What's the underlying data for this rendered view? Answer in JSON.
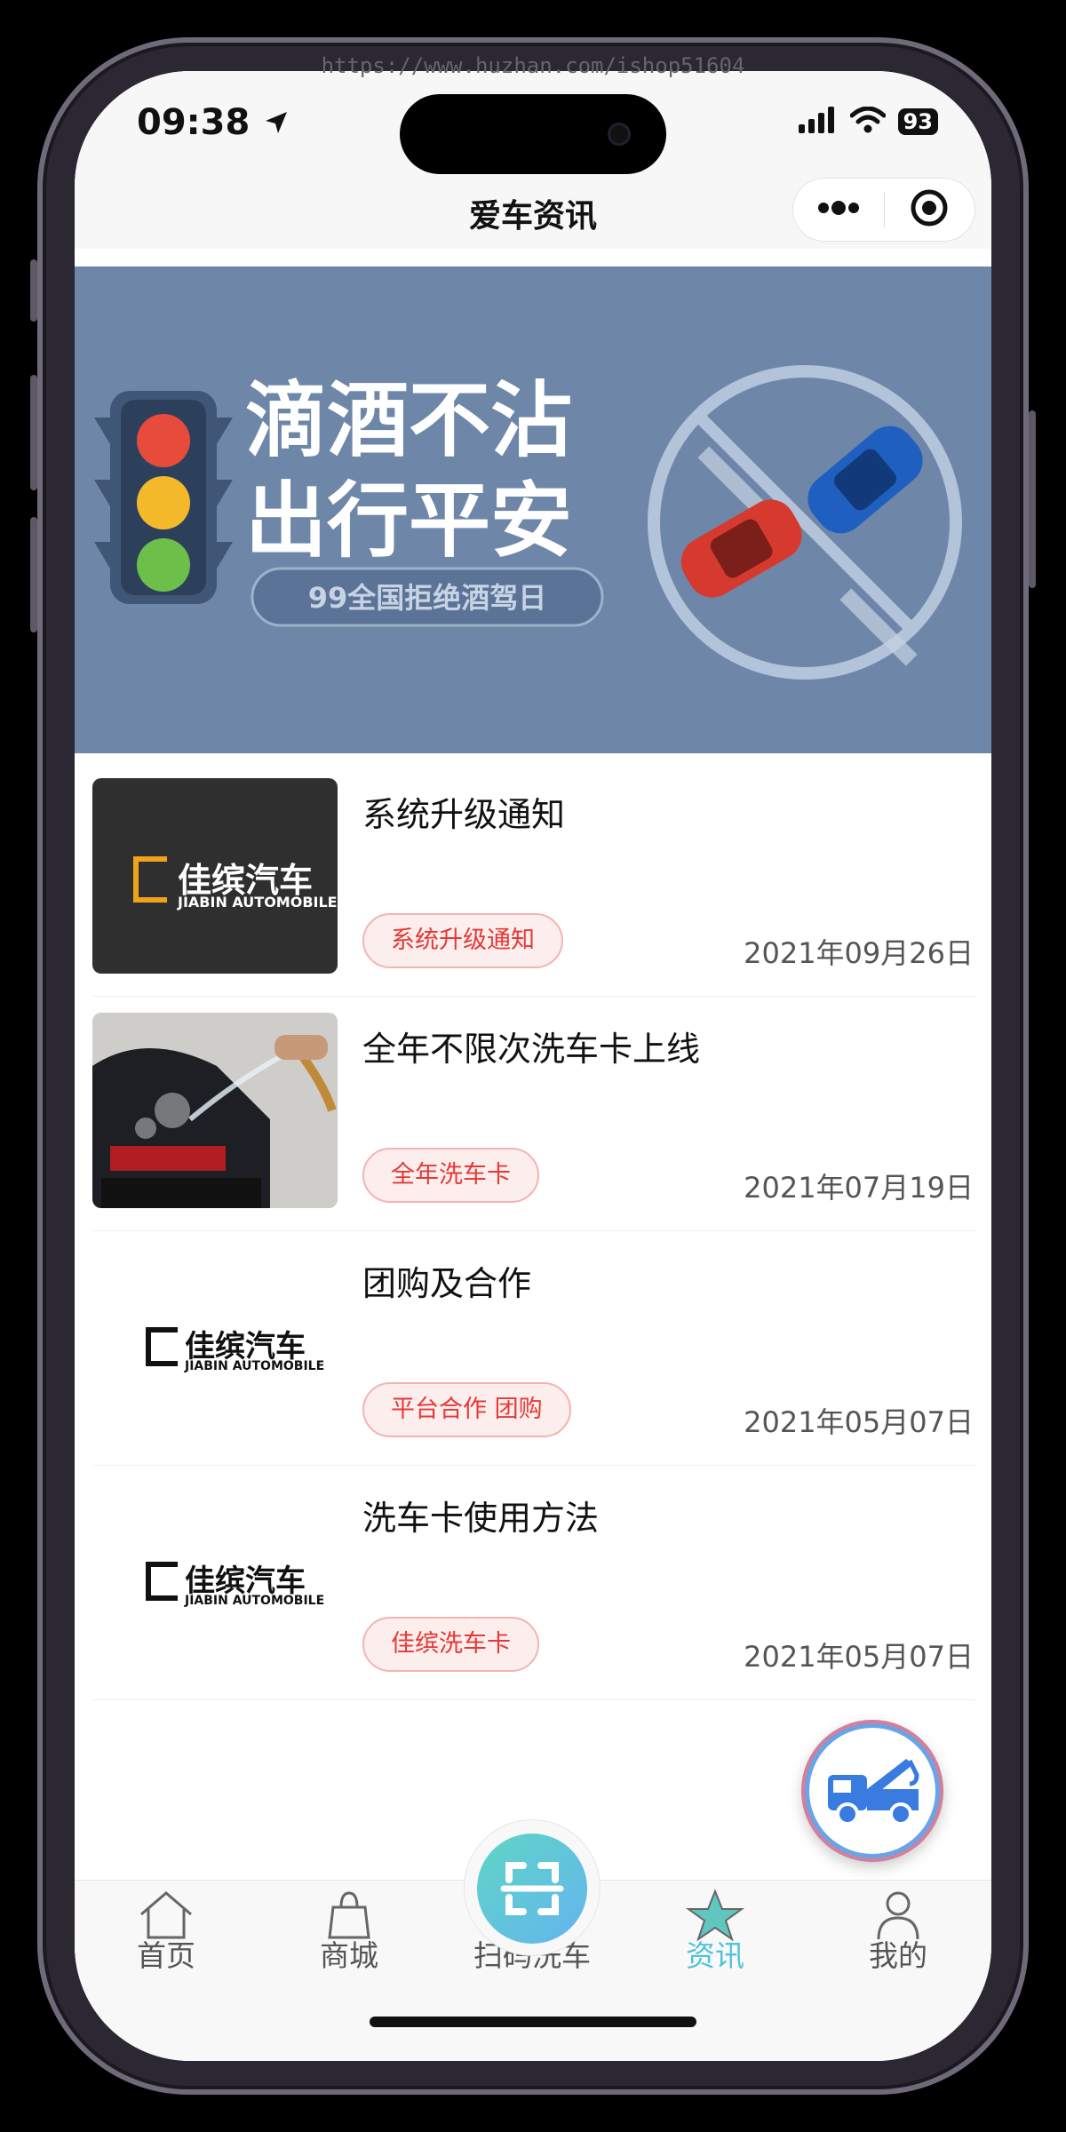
{
  "watermark": "https://www.huzhan.com/ishop51604",
  "status": {
    "time": "09:38",
    "battery": "93"
  },
  "navbar": {
    "title": "爱车资讯"
  },
  "banner": {
    "line1": "滴酒不沾",
    "line2": "出行平安",
    "sub": "99全国拒绝酒驾日"
  },
  "news": [
    {
      "title": "系统升级通知",
      "tag": "系统升级通知",
      "date": "2021年09月26日",
      "thumb_cn": "佳缤汽车",
      "thumb_en": "JIABIN AUTOMOBILE"
    },
    {
      "title": "全年不限次洗车卡上线",
      "tag": "全年洗车卡",
      "date": "2021年07月19日"
    },
    {
      "title": "团购及合作",
      "tag": "平台合作 团购",
      "date": "2021年05月07日",
      "thumb_cn": "佳缤汽车",
      "thumb_en": "JIABIN AUTOMOBILE"
    },
    {
      "title": "洗车卡使用方法",
      "tag": "佳缤洗车卡",
      "date": "2021年05月07日",
      "thumb_cn": "佳缤汽车",
      "thumb_en": "JIABIN AUTOMOBILE"
    }
  ],
  "tabbar": {
    "items": [
      {
        "label": "首页",
        "icon": "home-icon"
      },
      {
        "label": "商城",
        "icon": "shopping-bag-icon"
      },
      {
        "label": "扫码洗车",
        "icon": "scan-icon"
      },
      {
        "label": "资讯",
        "icon": "star-icon",
        "active": true
      },
      {
        "label": "我的",
        "icon": "person-icon"
      }
    ],
    "active_color": "#4fc3d9"
  },
  "colors": {
    "tag_text": "#e53935",
    "tag_bg": "#fdeeee",
    "banner_bg": "#6e87a8"
  }
}
